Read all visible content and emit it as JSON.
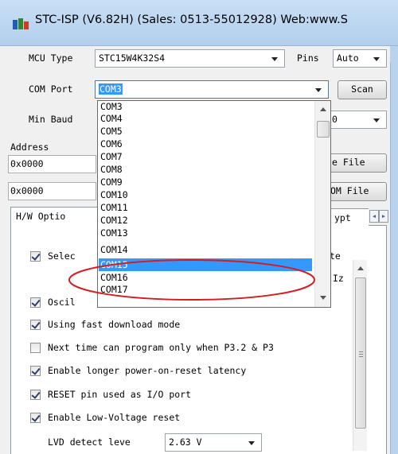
{
  "window": {
    "title": "STC-ISP (V6.82H) (Sales: 0513-55012928) Web:www.S"
  },
  "mcu": {
    "label": "MCU Type",
    "value": "STC15W4K32S4"
  },
  "pins": {
    "label": "Pins",
    "value": "Auto"
  },
  "com_port": {
    "label": "COM Port",
    "value": "COM3",
    "scan_label": "Scan"
  },
  "min_baud": {
    "label": "Min Baud",
    "value_fragment": "0"
  },
  "address": {
    "label": "Address",
    "row1_value": "0x0000",
    "row2_value": "0x0000",
    "open_file_label": "e File",
    "open_eeprom_label": "OM File"
  },
  "tabs": {
    "hw_options": "H/W Optio",
    "encrypt": "ypt"
  },
  "options": {
    "select_row": {
      "label": "Selec",
      "checked": true,
      "right_fragment": "te"
    },
    "freq_fragment": "Iz",
    "oscil_row": {
      "label": "Oscil",
      "checked": true
    },
    "items": [
      {
        "label": "Using fast download mode",
        "checked": true
      },
      {
        "label": "Next time can program only when P3.2 & P3",
        "checked": false
      },
      {
        "label": "Enable longer power-on-reset latency",
        "checked": true
      },
      {
        "label": "RESET pin used as I/O port",
        "checked": true
      },
      {
        "label": "Enable Low-Voltage reset",
        "checked": true
      }
    ],
    "lvd": {
      "label": "LVD detect leve",
      "value": "2.63 V"
    }
  },
  "dropdown": {
    "items": [
      "COM3",
      "COM4",
      "COM5",
      "COM6",
      "COM7",
      "COM8",
      "COM9",
      "COM10",
      "COM11",
      "COM12",
      "COM13",
      "COM14",
      "COM15",
      "COM16",
      "COM17"
    ],
    "highlighted": "COM15"
  },
  "colors": {
    "selection": "#3399ff",
    "annotation_ellipse": "#d21e23",
    "titlebar": "#bcd6f1"
  }
}
